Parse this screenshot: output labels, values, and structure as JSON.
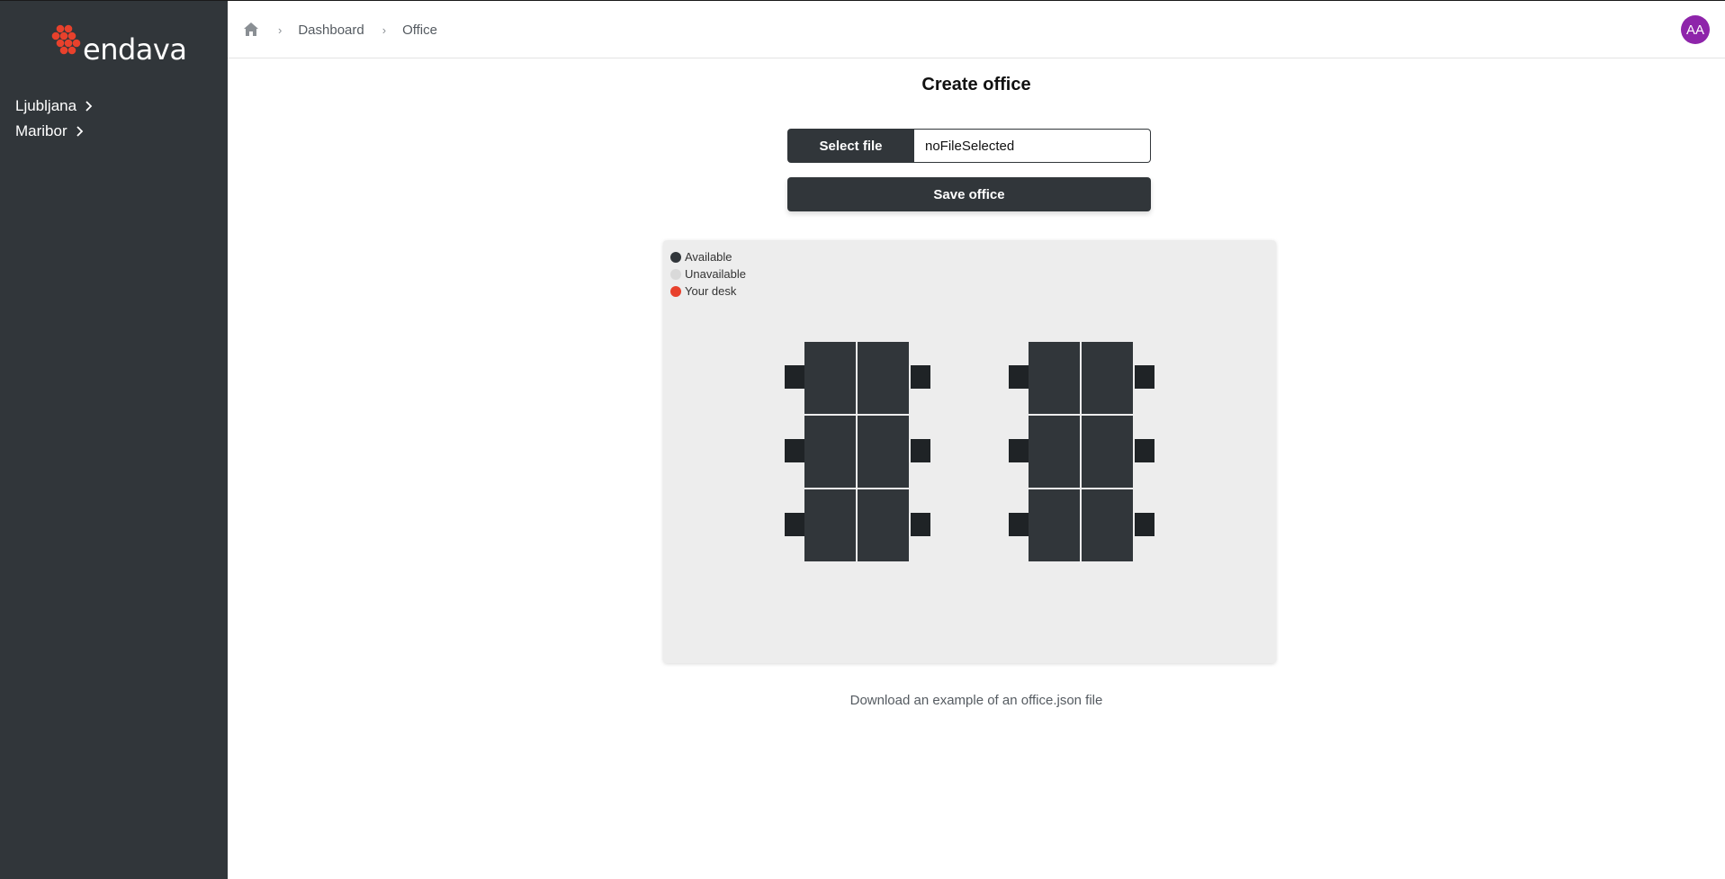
{
  "brand": {
    "name": "endava",
    "accent_color": "#e8412c"
  },
  "sidebar": {
    "items": [
      {
        "label": "Ljubljana",
        "icon": "chevron-right-icon"
      },
      {
        "label": "Maribor",
        "icon": "chevron-right-icon"
      }
    ]
  },
  "header": {
    "breadcrumb": [
      {
        "label": "Dashboard"
      },
      {
        "label": "Office"
      }
    ],
    "avatar_initials": "AA",
    "avatar_color": "#8e24aa"
  },
  "main": {
    "title": "Create office",
    "select_file_label": "Select file",
    "file_name": "noFileSelected",
    "save_label": "Save office",
    "download_link": "Download an example of an office.json file"
  },
  "legend": [
    {
      "label": "Available",
      "color": "#31363a"
    },
    {
      "label": "Unavailable",
      "color": "#d9d9d9"
    },
    {
      "label": "Your desk",
      "color": "#e8412c"
    }
  ],
  "desk_groups": [
    {
      "desks": [
        {
          "status": "available"
        },
        {
          "status": "available"
        },
        {
          "status": "available"
        },
        {
          "status": "available"
        },
        {
          "status": "available"
        },
        {
          "status": "available"
        }
      ]
    },
    {
      "desks": [
        {
          "status": "available"
        },
        {
          "status": "available"
        },
        {
          "status": "available"
        },
        {
          "status": "available"
        },
        {
          "status": "available"
        },
        {
          "status": "available"
        }
      ]
    }
  ]
}
